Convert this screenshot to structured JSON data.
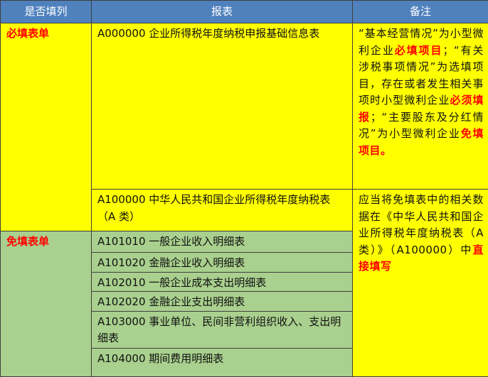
{
  "headers": [
    "是否填列",
    "报表",
    "备注"
  ],
  "categories": {
    "required": "必填表单",
    "exempt": "免填表单"
  },
  "reports": [
    "A000000 企业所得税年度纳税申报基础信息表",
    "A100000 中华人民共和国企业所得税年度纳税表（A 类）",
    "A101010 一般企业收入明细表",
    "A101020 金融企业收入明细表",
    "A102010 一般企业成本支出明细表",
    "A102020 金融企业支出明细表",
    "A103000 事业单位、民间非营利组织收入、支出明细表",
    "A104000 期间费用明细表"
  ],
  "notes": {
    "note1": [
      {
        "t": "“基本经营情况”为小型微利企业",
        "em": false
      },
      {
        "t": "必填项目",
        "em": true
      },
      {
        "t": "；“有关涉税事项情况”为选填项目，存在或者发生相关事项时小型微利企业",
        "em": false
      },
      {
        "t": "必须填报",
        "em": true
      },
      {
        "t": "；“主要股东及分红情况”为小型微利企业",
        "em": false
      },
      {
        "t": "免填项目。",
        "em": true
      }
    ],
    "note2": [
      {
        "t": "应当将免填表中的相关数据在《中华人民共和国企业所得税年度纳税表（A类）》（A100000）中",
        "em": false
      },
      {
        "t": "直接填写",
        "em": true
      }
    ]
  },
  "colors": {
    "header_bg": "#4f81bd",
    "required_bg": "#ffff00",
    "exempt_bg": "#a9d08e",
    "emphasis": "#ff0000"
  }
}
